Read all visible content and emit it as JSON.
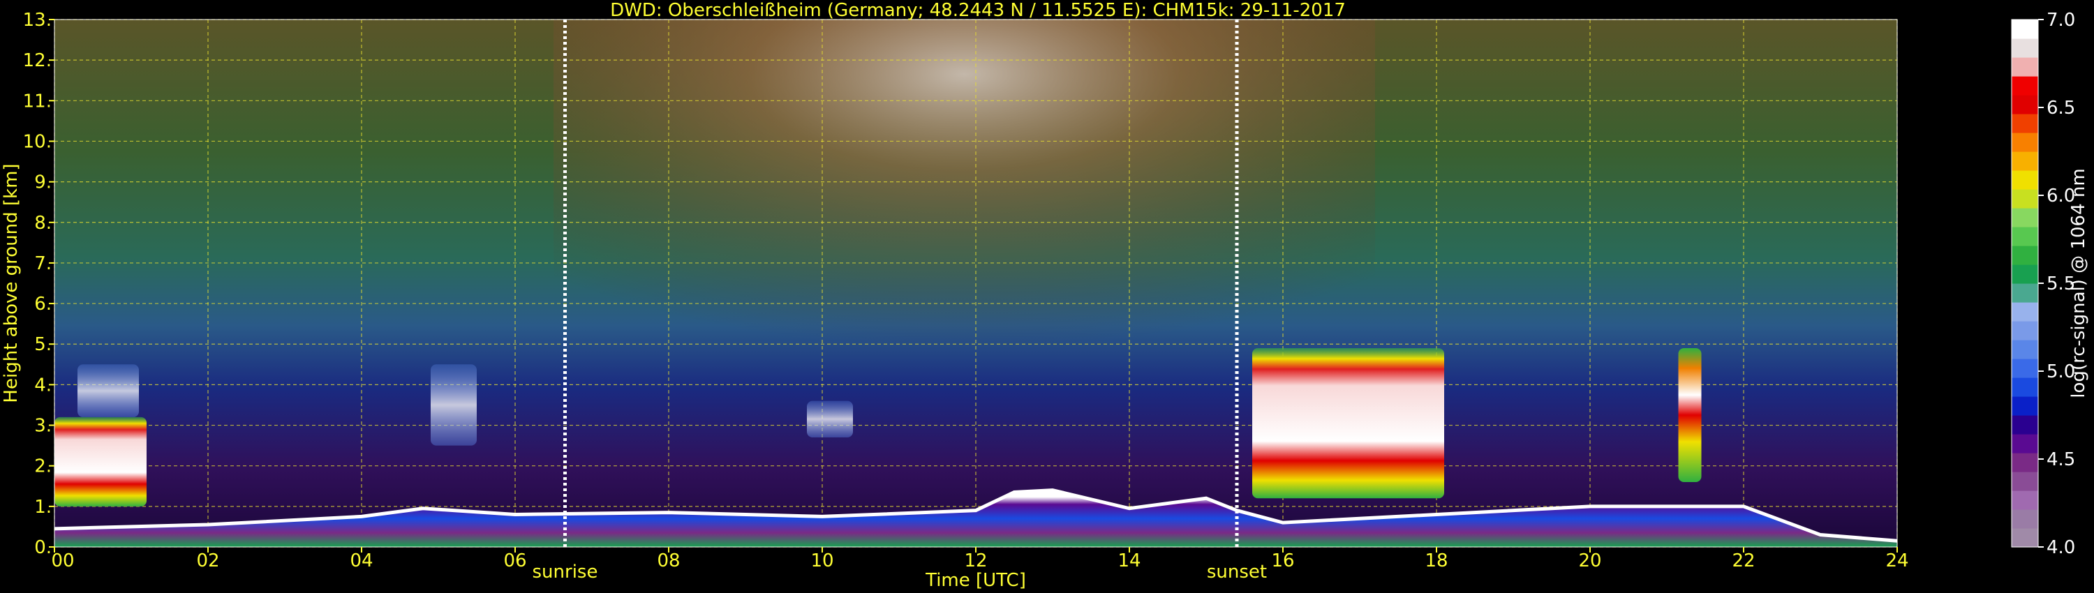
{
  "chart_data": {
    "type": "heatmap",
    "title": "DWD: Oberschleißheim (Germany; 48.2443 N / 11.5525 E):    CHM15k: 29-11-2017",
    "xlabel": "Time [UTC]",
    "ylabel": "Height above ground [km]",
    "xlim": [
      0,
      24
    ],
    "ylim": [
      0,
      13
    ],
    "x_ticks": [
      "00",
      "02",
      "04",
      "06",
      "08",
      "10",
      "12",
      "14",
      "16",
      "18",
      "20",
      "22",
      "24"
    ],
    "y_ticks": [
      "0.",
      "1.",
      "2.",
      "3.",
      "4.",
      "5.",
      "6.",
      "7.",
      "8.",
      "9.",
      "10.",
      "11.",
      "12.",
      "13."
    ],
    "grid": true,
    "markers": [
      {
        "label": "sunrise",
        "time": 6.65
      },
      {
        "label": "sunset",
        "time": 15.4
      }
    ],
    "colorbar": {
      "label": "log(rc-signal) @ 1064 nm",
      "range": [
        4.0,
        7.0
      ],
      "ticks": [
        "4.0",
        "4.5",
        "5.0",
        "5.5",
        "6.0",
        "6.5",
        "7.0"
      ],
      "colors": [
        "#a08aa8",
        "#9a7ca6",
        "#a06ab0",
        "#8a4c96",
        "#7a2a86",
        "#5a0a92",
        "#2a0090",
        "#0a20c8",
        "#1a4ae0",
        "#3a6ae8",
        "#5a86e8",
        "#7a9ae8",
        "#98b2ec",
        "#4aa890",
        "#18a050",
        "#30b040",
        "#58c850",
        "#88d860",
        "#c8e020",
        "#f0e000",
        "#f8b000",
        "#f88000",
        "#f04000",
        "#e00000",
        "#f00000",
        "#f0b0b0",
        "#e8e0e0",
        "#ffffff"
      ]
    },
    "cloud_layers": [
      {
        "start": 0.0,
        "end": 1.2,
        "base": 1.0,
        "top": 3.2,
        "intensity": "high"
      },
      {
        "start": 0.3,
        "end": 1.1,
        "base": 3.2,
        "top": 4.5,
        "intensity": "low"
      },
      {
        "start": 4.9,
        "end": 5.5,
        "base": 2.5,
        "top": 4.5,
        "intensity": "low"
      },
      {
        "start": 9.8,
        "end": 10.4,
        "base": 2.7,
        "top": 3.6,
        "intensity": "low"
      },
      {
        "start": 15.6,
        "end": 18.1,
        "base": 1.2,
        "top": 4.9,
        "intensity": "high"
      },
      {
        "start": 21.15,
        "end": 21.45,
        "base": 1.6,
        "top": 4.9,
        "intensity": "medium"
      }
    ],
    "boundary_layer_top_km": [
      [
        0,
        0.45
      ],
      [
        2,
        0.55
      ],
      [
        4,
        0.75
      ],
      [
        4.8,
        0.95
      ],
      [
        6,
        0.8
      ],
      [
        8,
        0.85
      ],
      [
        10,
        0.75
      ],
      [
        12,
        0.9
      ],
      [
        12.5,
        1.35
      ],
      [
        13,
        1.4
      ],
      [
        14,
        0.95
      ],
      [
        15,
        1.2
      ],
      [
        15.4,
        0.9
      ],
      [
        16,
        0.6
      ],
      [
        18,
        0.8
      ],
      [
        20,
        1.0
      ],
      [
        22,
        1.0
      ],
      [
        23,
        0.3
      ],
      [
        24,
        0.15
      ]
    ]
  }
}
